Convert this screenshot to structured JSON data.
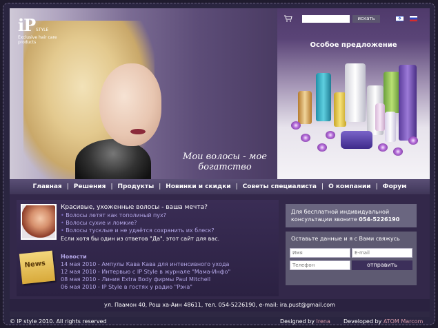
{
  "header": {
    "logo_mark": "iP",
    "logo_style": "STYLE",
    "logo_tagline": "Exclusive hair care products",
    "slogan": "Мои волосы - мое богатство",
    "search": {
      "placeholder": "",
      "button_label": "искать"
    },
    "promo_title": "Особое предложение"
  },
  "nav": {
    "items": [
      "Главная",
      "Решения",
      "Продукты",
      "Новинки и скидки",
      "Советы специалиста",
      "О компании",
      "Форум"
    ]
  },
  "intro": {
    "title": "Красивые, ухоженные волосы - ваша мечта?",
    "questions": [
      "Волосы летят как тополиный пух?",
      "Волосы сухие и ломкие?",
      "Волосы тусклые и не удаётся сохранить их блеск?"
    ],
    "cta": "Если хотя бы один из ответов \"Да\", этот сайт для вас."
  },
  "news": {
    "icon_label": "News",
    "title": "Новости",
    "items": [
      "14 мая 2010 - Ампулы Кава Кава для интенсивного ухода",
      "12 мая 2010 - Интервью с IP Style в журнале \"Мама-Инфо\"",
      "08 мая 2010 - Линия Extra Body фирмы Paul Mitchell",
      "06 мая 2010 - IP Style в гостях у радио \"Рэка\""
    ]
  },
  "consult": {
    "text": "Для бесплатной индивидуальной консультации звоните",
    "phone": "054-5226190"
  },
  "contact_form": {
    "title": "Оставьте данные и я с Вами свяжусь",
    "name_placeholder": "Имя",
    "email_placeholder": "E-mail",
    "phone_placeholder": "Телефон",
    "submit_label": "отправить"
  },
  "address": "ул. Паамон 40, Рош ха-Аин 48611, тел. 054-5226190, e-mail: ira.pust@gmail.com",
  "footer": {
    "copyright": "© IP style 2010. All rights reserved",
    "designed_by": "Designed by",
    "designer": "Irena",
    "developed_by": "Developed by",
    "developer": "ATOM Marcom"
  },
  "colors": {
    "accent": "#d69aa9",
    "link": "#b3a6e6",
    "nav_bg": "#4a4066",
    "panel": "#6a6680"
  }
}
